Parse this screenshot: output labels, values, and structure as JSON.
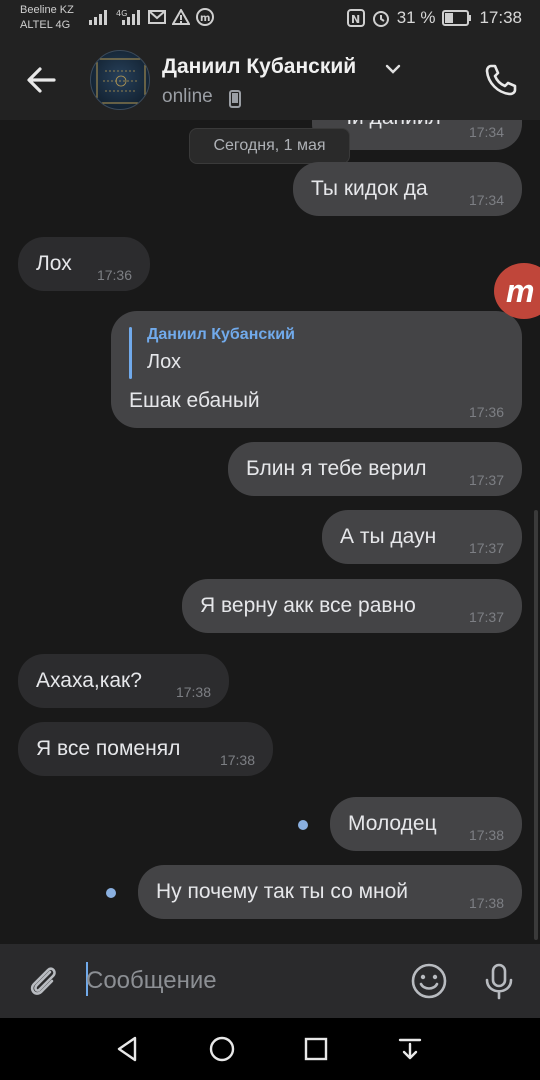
{
  "status_bar": {
    "carrier_1": "Beeline KZ",
    "carrier_2": "ALTEL 4G",
    "battery": "31 %",
    "time": "17:38"
  },
  "header": {
    "contact_name": "Даниил Кубанский",
    "status": "online"
  },
  "chat": {
    "date_separator": "Сегодня, 1 мая",
    "partial_message": {
      "text": "Чи даниил",
      "time": "17:34"
    },
    "messages": [
      {
        "dir": "out",
        "text": "Ты кидок да",
        "time": "17:34"
      },
      {
        "dir": "in",
        "text": "Лох",
        "time": "17:36"
      },
      {
        "dir": "out",
        "reply_author": "Даниил Кубанский",
        "reply_text": "Лох",
        "text": "Ешак ебаный",
        "time": "17:36"
      },
      {
        "dir": "out",
        "text": "Блин я тебе верил",
        "time": "17:37"
      },
      {
        "dir": "out",
        "text": "А ты даун",
        "time": "17:37"
      },
      {
        "dir": "out",
        "text": "Я верну акк все равно",
        "time": "17:37"
      },
      {
        "dir": "in",
        "text": "Ахаха,как?",
        "time": "17:38"
      },
      {
        "dir": "in",
        "text": "Я все поменял",
        "time": "17:38"
      },
      {
        "dir": "out",
        "text": "Молодец",
        "time": "17:38",
        "unread": true
      },
      {
        "dir": "out",
        "text": "Ну почему так ты со мной",
        "time": "17:38",
        "unread": true
      }
    ],
    "floating_badge": "m"
  },
  "composer": {
    "placeholder": "Сообщение"
  },
  "colors": {
    "background": "#191919",
    "outgoing_bubble": "#444446",
    "incoming_bubble": "#2c2c2e",
    "accent": "#71aaeb",
    "badge": "#c0463a"
  }
}
